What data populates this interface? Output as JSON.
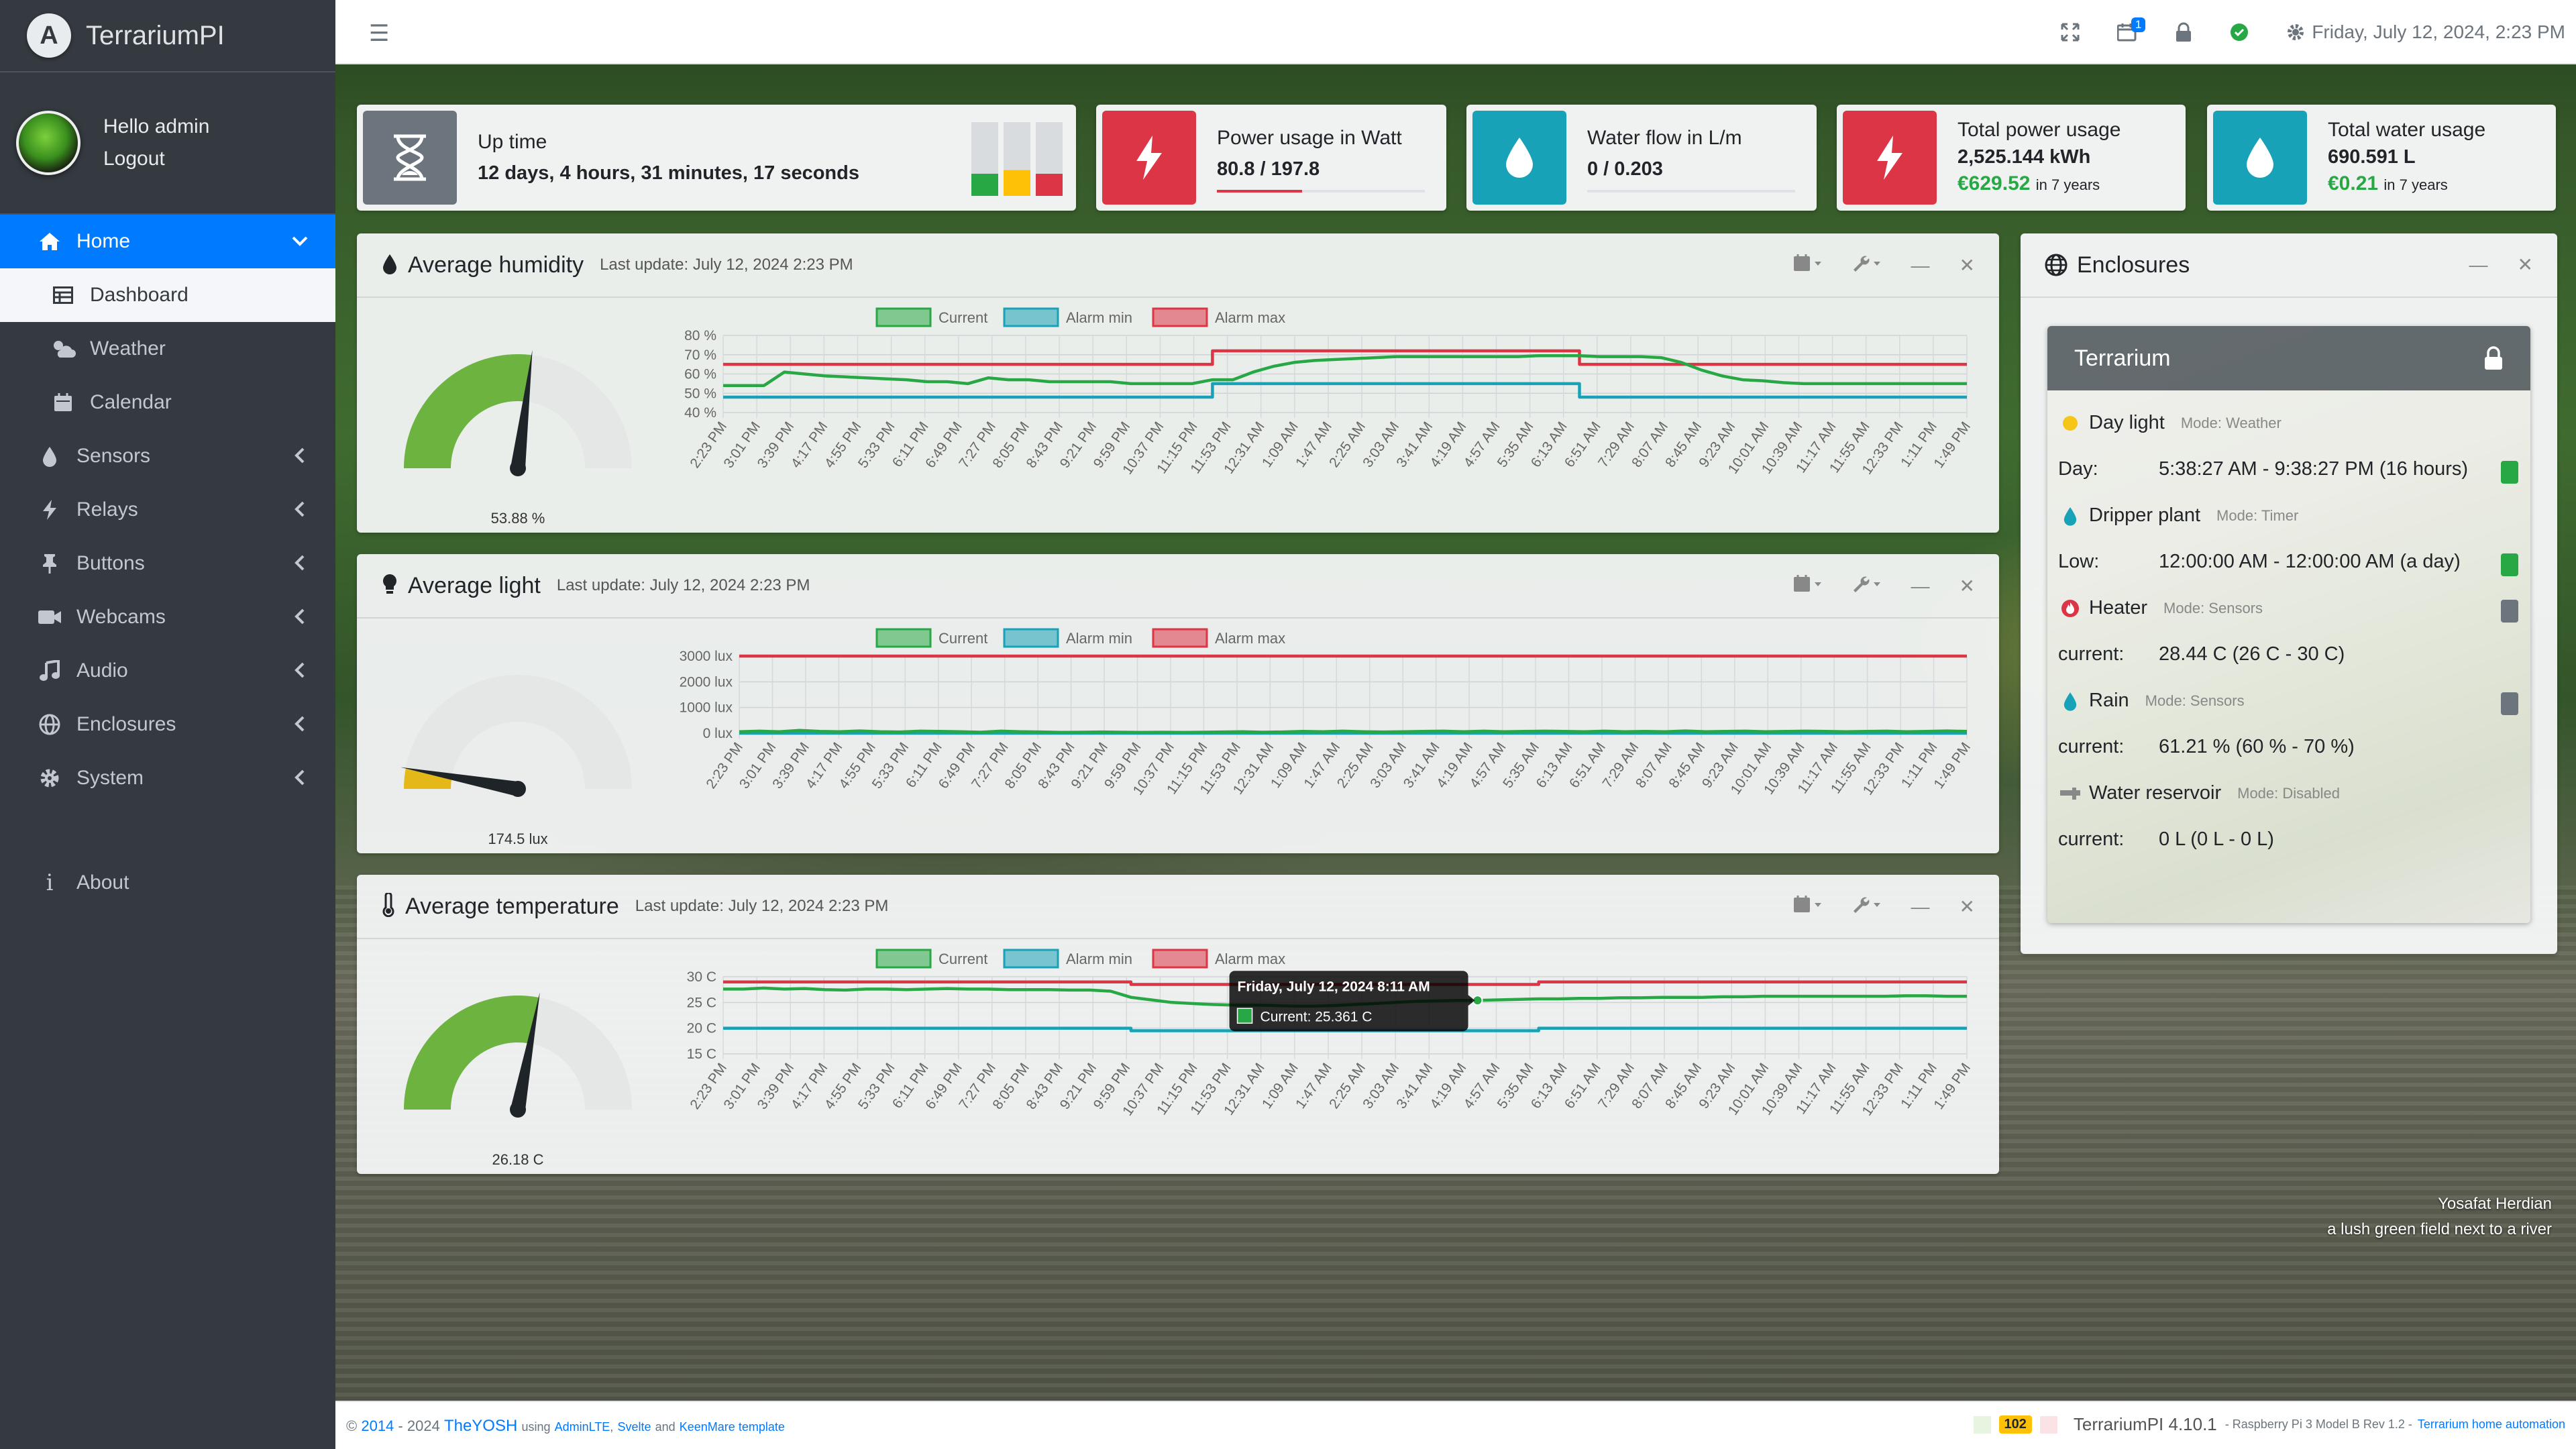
{
  "app": {
    "name": "TerrariumPI",
    "logo_letter": "A"
  },
  "user": {
    "greeting": "Hello admin",
    "logout": "Logout"
  },
  "sidebar": {
    "items": [
      {
        "label": "Home",
        "icon": "home-icon",
        "active": true,
        "chevron": "down"
      },
      {
        "label": "Dashboard",
        "icon": "table-icon",
        "sub": true,
        "current": true
      },
      {
        "label": "Weather",
        "icon": "cloud-sun-icon",
        "sub": true
      },
      {
        "label": "Calendar",
        "icon": "calendar-icon",
        "sub": true
      },
      {
        "label": "Sensors",
        "icon": "drop-icon",
        "chevron": "left"
      },
      {
        "label": "Relays",
        "icon": "bolt-icon",
        "chevron": "left"
      },
      {
        "label": "Buttons",
        "icon": "thumbtack-icon",
        "chevron": "left"
      },
      {
        "label": "Webcams",
        "icon": "video-icon",
        "chevron": "left"
      },
      {
        "label": "Audio",
        "icon": "music-icon",
        "chevron": "left"
      },
      {
        "label": "Enclosures",
        "icon": "globe-icon",
        "chevron": "left"
      },
      {
        "label": "System",
        "icon": "gear-icon",
        "chevron": "left"
      }
    ],
    "about": "About"
  },
  "topbar": {
    "datetime": "Friday, July 12, 2024, 2:23 PM",
    "notification_count": "1"
  },
  "info_boxes": {
    "uptime": {
      "title": "Up time",
      "value": "12 days, 4 hours, 31 minutes, 17 seconds",
      "load_levels": [
        0.3,
        0.35,
        0.3
      ],
      "load_colors": [
        "#28a745",
        "#ffc107",
        "#dc3545"
      ]
    },
    "power": {
      "title": "Power usage in Watt",
      "value": "80.8 / 197.8",
      "fill_fraction": 0.41
    },
    "water": {
      "title": "Water flow in L/m",
      "value": "0 / 0.203",
      "fill_fraction": 0
    },
    "total_power": {
      "title": "Total power usage",
      "value": "2,525.144 kWh",
      "cost": "€629.52",
      "period": "in 7 years"
    },
    "total_water": {
      "title": "Total water usage",
      "value": "690.591 L",
      "cost": "€0.21",
      "period": "in 7 years"
    }
  },
  "x_labels": [
    "2:23 PM",
    "3:01 PM",
    "3:39 PM",
    "4:17 PM",
    "4:55 PM",
    "5:33 PM",
    "6:11 PM",
    "6:49 PM",
    "7:27 PM",
    "8:05 PM",
    "8:43 PM",
    "9:21 PM",
    "9:59 PM",
    "10:37 PM",
    "11:15 PM",
    "11:53 PM",
    "12:31 AM",
    "1:09 AM",
    "1:47 AM",
    "2:25 AM",
    "3:03 AM",
    "3:41 AM",
    "4:19 AM",
    "4:57 AM",
    "5:35 AM",
    "6:13 AM",
    "6:51 AM",
    "7:29 AM",
    "8:07 AM",
    "8:45 AM",
    "9:23 AM",
    "10:01 AM",
    "10:39 AM",
    "11:17 AM",
    "11:55 AM",
    "12:33 PM",
    "1:11 PM",
    "1:49 PM"
  ],
  "legend": [
    "Current",
    "Alarm min",
    "Alarm max"
  ],
  "colors": {
    "current": "#28a745",
    "alarm_min": "#17a2b8",
    "alarm_max": "#dc3545"
  },
  "charts": {
    "humidity": {
      "title": "Average humidity",
      "updated": "Last update: July 12, 2024 2:23 PM",
      "gauge_value": 53.88,
      "gauge_min": 0,
      "gauge_max": 100,
      "gauge_label": "53.88 %",
      "gauge_color": "#6cb33f",
      "chart_data": {
        "type": "line",
        "y_ticks": [
          "40 %",
          "50 %",
          "60 %",
          "70 %",
          "80 %"
        ],
        "ylim": [
          40,
          80
        ],
        "series": [
          {
            "name": "Current",
            "values": [
              54,
              54,
              54,
              61,
              60,
              59,
              58.5,
              58,
              57.5,
              57,
              56,
              56,
              55,
              58,
              57,
              57,
              56,
              56,
              56,
              56,
              55,
              55,
              55,
              55,
              57,
              57,
              61,
              64,
              66,
              67,
              67.5,
              68,
              68.5,
              69,
              69,
              69,
              69,
              69,
              69,
              69,
              69.5,
              69.5,
              69.5,
              69,
              69,
              69,
              68.5,
              66,
              62,
              59,
              57,
              56.5,
              55.5,
              55,
              55,
              55,
              55,
              55,
              55,
              55,
              55,
              55
            ]
          },
          {
            "name": "Alarm min",
            "values": [
              48,
              48,
              48,
              48,
              48,
              48,
              48,
              48,
              48,
              48,
              48,
              48,
              48,
              48,
              48,
              48,
              48,
              48,
              48,
              48,
              48,
              48,
              48,
              48,
              55,
              55,
              55,
              55,
              55,
              55,
              55,
              55,
              55,
              55,
              55,
              55,
              55,
              55,
              55,
              55,
              55,
              55,
              48,
              48,
              48,
              48,
              48,
              48,
              48,
              48,
              48,
              48,
              48,
              48,
              48,
              48,
              48,
              48,
              48,
              48,
              48,
              48
            ]
          },
          {
            "name": "Alarm max",
            "values": [
              65,
              65,
              65,
              65,
              65,
              65,
              65,
              65,
              65,
              65,
              65,
              65,
              65,
              65,
              65,
              65,
              65,
              65,
              65,
              65,
              65,
              65,
              65,
              65,
              72,
              72,
              72,
              72,
              72,
              72,
              72,
              72,
              72,
              72,
              72,
              72,
              72,
              72,
              72,
              72,
              72,
              72,
              65,
              65,
              65,
              65,
              65,
              65,
              65,
              65,
              65,
              65,
              65,
              65,
              65,
              65,
              65,
              65,
              65,
              65,
              65,
              65
            ]
          }
        ]
      }
    },
    "light": {
      "title": "Average light",
      "updated": "Last update: July 12, 2024 2:23 PM",
      "gauge_value": 174.5,
      "gauge_min": 0,
      "gauge_max": 3000,
      "gauge_label": "174.5 lux",
      "gauge_color": "#e5b81a",
      "chart_data": {
        "type": "line",
        "y_ticks": [
          "0 lux",
          "1000 lux",
          "2000 lux",
          "3000 lux"
        ],
        "ylim": [
          0,
          3000
        ],
        "series": [
          {
            "name": "Current",
            "values": [
              60,
              80,
              60,
              110,
              70,
              60,
              90,
              60,
              50,
              80,
              70,
              60,
              40,
              80,
              60,
              50,
              30,
              40,
              50,
              40,
              30,
              40,
              30,
              40,
              50,
              60,
              40,
              50,
              70,
              60,
              80,
              60,
              50,
              60,
              70,
              80,
              60,
              80,
              60,
              70,
              80,
              70,
              60,
              80,
              60,
              70,
              60,
              90,
              60,
              70,
              80,
              60,
              70,
              80,
              70,
              60,
              70,
              80,
              60,
              70,
              90,
              70
            ]
          },
          {
            "name": "Alarm min",
            "values": [
              0,
              0,
              0,
              0,
              0,
              0,
              0,
              0,
              0,
              0,
              0,
              0,
              0,
              0,
              0,
              0,
              0,
              0,
              0,
              0,
              0,
              0,
              0,
              0,
              0,
              0,
              0,
              0,
              0,
              0,
              0,
              0,
              0,
              0,
              0,
              0,
              0,
              0,
              0,
              0,
              0,
              0,
              0,
              0,
              0,
              0,
              0,
              0,
              0,
              0,
              0,
              0,
              0,
              0,
              0,
              0,
              0,
              0,
              0,
              0,
              0,
              0
            ]
          },
          {
            "name": "Alarm max",
            "values": [
              3000,
              3000,
              3000,
              3000,
              3000,
              3000,
              3000,
              3000,
              3000,
              3000,
              3000,
              3000,
              3000,
              3000,
              3000,
              3000,
              3000,
              3000,
              3000,
              3000,
              3000,
              3000,
              3000,
              3000,
              3000,
              3000,
              3000,
              3000,
              3000,
              3000,
              3000,
              3000,
              3000,
              3000,
              3000,
              3000,
              3000,
              3000,
              3000,
              3000,
              3000,
              3000,
              3000,
              3000,
              3000,
              3000,
              3000,
              3000,
              3000,
              3000,
              3000,
              3000,
              3000,
              3000,
              3000,
              3000,
              3000,
              3000,
              3000,
              3000,
              3000,
              3000
            ]
          }
        ]
      }
    },
    "temperature": {
      "title": "Average temperature",
      "updated": "Last update: July 12, 2024 2:23 PM",
      "gauge_value": 26.18,
      "gauge_min": 15,
      "gauge_max": 35,
      "gauge_label": "26.18 C",
      "gauge_color": "#6cb33f",
      "chart_data": {
        "type": "line",
        "y_ticks": [
          "15 C",
          "20 C",
          "25 C",
          "30 C"
        ],
        "ylim": [
          15,
          30
        ],
        "series": [
          {
            "name": "Current",
            "values": [
              27.6,
              27.6,
              27.8,
              27.6,
              27.7,
              27.5,
              27.4,
              27.6,
              27.6,
              27.5,
              27.6,
              27.7,
              27.6,
              27.6,
              27.5,
              27.5,
              27.5,
              27.4,
              27.4,
              27.2,
              26,
              25.5,
              25,
              24.8,
              24.6,
              24.5,
              24.5,
              24.4,
              24.3,
              24.3,
              24.4,
              24.6,
              24.8,
              25,
              25.2,
              25.3,
              25.4,
              25.4,
              25.5,
              25.6,
              25.7,
              25.7,
              25.8,
              25.8,
              25.9,
              25.9,
              26,
              26,
              26,
              26.1,
              26.1,
              26.2,
              26.2,
              26.2,
              26.2,
              26.2,
              26.2,
              26.2,
              26.3,
              26.3,
              26.2,
              26.2
            ]
          },
          {
            "name": "Alarm min",
            "values": [
              20,
              20,
              20,
              20,
              20,
              20,
              20,
              20,
              20,
              20,
              20,
              20,
              20,
              20,
              20,
              20,
              20,
              20,
              20,
              20,
              19.5,
              19.5,
              19.5,
              19.5,
              19.5,
              19.5,
              19.5,
              19.5,
              19.5,
              19.5,
              19.5,
              19.5,
              19.5,
              19.5,
              19.5,
              19.5,
              19.5,
              19.5,
              19.5,
              19.5,
              20,
              20,
              20,
              20,
              20,
              20,
              20,
              20,
              20,
              20,
              20,
              20,
              20,
              20,
              20,
              20,
              20,
              20,
              20,
              20,
              20,
              20
            ]
          },
          {
            "name": "Alarm max",
            "values": [
              29,
              29,
              29,
              29,
              29,
              29,
              29,
              29,
              29,
              29,
              29,
              29,
              29,
              29,
              29,
              29,
              29,
              29,
              29,
              29,
              28.5,
              28.5,
              28.5,
              28.5,
              28.5,
              28.5,
              28.5,
              28.5,
              28.5,
              28.5,
              28.5,
              28.5,
              28.5,
              28.5,
              28.5,
              28.5,
              28.5,
              28.5,
              28.5,
              28.5,
              29,
              29,
              29,
              29,
              29,
              29,
              29,
              29,
              29,
              29,
              29,
              29,
              29,
              29,
              29,
              29,
              29,
              29,
              29,
              29,
              29,
              29
            ]
          }
        ]
      },
      "tooltip": {
        "title": "Friday, July 12, 2024 8:11 AM",
        "text": "Current: 25.361 C",
        "index": 37
      }
    }
  },
  "enclosures": {
    "title": "Enclosures",
    "terrarium": {
      "name": "Terrarium",
      "rows": [
        {
          "type": "header",
          "icon": "sun-icon",
          "name": "Day light",
          "mode": "Mode: Weather"
        },
        {
          "type": "value",
          "label": "Day:",
          "value": "5:38:27 AM - 9:38:27 PM (16 hours)",
          "status": "#28a745"
        },
        {
          "type": "header",
          "icon": "drop-icon",
          "name": "Dripper plant",
          "mode": "Mode: Timer"
        },
        {
          "type": "value",
          "label": "Low:",
          "value": "12:00:00 AM - 12:00:00 AM (a day)",
          "status": "#28a745"
        },
        {
          "type": "header",
          "icon": "fire-icon",
          "name": "Heater",
          "mode": "Mode: Sensors",
          "status": "#6c757d"
        },
        {
          "type": "value",
          "label": "current:",
          "value": "28.44 C (26 C - 30 C)"
        },
        {
          "type": "header",
          "icon": "drop-icon",
          "name": "Rain",
          "mode": "Mode: Sensors",
          "status": "#6c757d"
        },
        {
          "type": "value",
          "label": "current:",
          "value": "61.21 % (60 % - 70 %)"
        },
        {
          "type": "header",
          "icon": "faucet-icon",
          "name": "Water reservoir",
          "mode": "Mode: Disabled"
        },
        {
          "type": "value",
          "label": "current:",
          "value": "0 L (0 L - 0 L)"
        }
      ]
    }
  },
  "photo_credit": {
    "author": "Yosafat Herdian",
    "caption": "a lush green field next to a river"
  },
  "footer": {
    "copyright": "©",
    "year_start": "2014",
    "year_end": "- 2024",
    "author": "TheYOSH",
    "using": "using",
    "adminlte": "AdminLTE",
    "svelte": "Svelte",
    "and": "and",
    "template": "KeenMare template",
    "count_badge": "102",
    "version": "TerrariumPI 4.10.1",
    "hardware": "- Raspberry Pi 3 Model B Rev 1.2 -",
    "tagline": "Terrarium home automation"
  }
}
